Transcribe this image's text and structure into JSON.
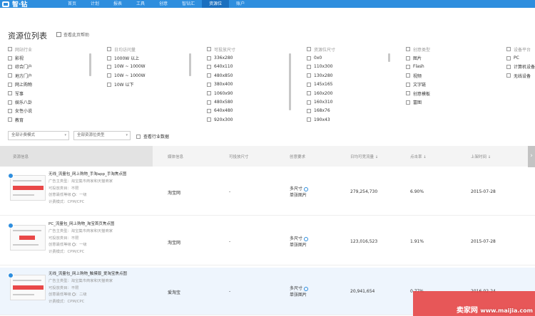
{
  "brand": {
    "name": "智·钻"
  },
  "nav": [
    {
      "label": "首页"
    },
    {
      "label": "计划"
    },
    {
      "label": "报表"
    },
    {
      "label": "工具"
    },
    {
      "label": "创意"
    },
    {
      "label": "智钻汇"
    },
    {
      "label": "资源位"
    },
    {
      "label": "账户"
    }
  ],
  "page": {
    "title": "资源位列表",
    "help": "查看此页帮助"
  },
  "filters": {
    "industry": {
      "header": "网站行业",
      "items": [
        "影视",
        "综合门户",
        "地方门户",
        "网上购物",
        "军事",
        "娱乐八卦",
        "女性小说",
        "教育"
      ]
    },
    "traffic": {
      "header": "日均访问量",
      "items": [
        "1000W 以上",
        "10W ~ 1000W",
        "10W ~ 1000W",
        "10W 以下"
      ]
    },
    "size": {
      "header": "可投放尺寸",
      "items": [
        "336x280",
        "640x110",
        "480x850",
        "380x400",
        "1060x90",
        "480x580",
        "640x480",
        "920x300"
      ]
    },
    "res": {
      "header": "资源位尺寸",
      "items": [
        "0x0",
        "110x300",
        "130x280",
        "145x165",
        "160x200",
        "160x310",
        "168x76",
        "190x43"
      ]
    },
    "creative": {
      "header": "创意类型",
      "items": [
        "图片",
        "Flash",
        "视频",
        "文字链",
        "创意模板",
        "富图"
      ]
    },
    "device": {
      "header": "设备平台",
      "items": [
        "PC",
        "计算机设备",
        "无线设备"
      ]
    }
  },
  "selects": {
    "billing": "全部计费模式",
    "restype": "全部资源位类型",
    "industry_data": "查看行业数据"
  },
  "table": {
    "headers": {
      "info": "资源信息",
      "media": "媒体信息",
      "size": "可投放尺寸",
      "creative": "创意要求",
      "traffic": "日均可竞流量 ↓",
      "ctr": "点击率 ↓",
      "date": "上架时间 ↓"
    },
    "rows": [
      {
        "name": "无线_流量包_网上购物_手淘app_手淘焦点图",
        "l1": "广告主类型：淘宝集市商家和天猫商家",
        "l2": "可投放类目：不限",
        "l3": "创意最低等级",
        "l3b": "一级",
        "l4": "计费模式：CPM/CPC",
        "media": "淘宝网",
        "size": "-",
        "cr1": "多尺寸",
        "cr2": "单张图片",
        "traffic": "279,254,730",
        "ctr": "6.90%",
        "date": "2015-07-28"
      },
      {
        "name": "PC_流量包_网上购物_淘宝首页焦点图",
        "l1": "广告主类型：淘宝集市商家和天猫商家",
        "l2": "可投放类目：不限",
        "l3": "创意最低等级",
        "l3b": "一级",
        "l4": "计费模式：CPM/CPC",
        "media": "淘宝网",
        "size": "-",
        "cr1": "多尺寸",
        "cr2": "单张图片",
        "traffic": "123,016,523",
        "ctr": "1.91%",
        "date": "2015-07-28"
      },
      {
        "name": "无线_流量包_网上购物_触摸版_爱淘宝焦点图",
        "l1": "广告主类型：淘宝集市商家和天猫商家",
        "l2": "可投放类目：不限",
        "l3": "创意最低等级",
        "l3b": "二级",
        "l4": "计费模式：CPM/CPC",
        "media": "爱淘宝",
        "size": "-",
        "cr1": "多尺寸",
        "cr2": "单张图片",
        "traffic": "20,941,654",
        "ctr": "0.77%",
        "date": "2016-02-24"
      }
    ]
  },
  "watermark": {
    "site": "卖家网",
    "url": "www.maijia.com"
  }
}
